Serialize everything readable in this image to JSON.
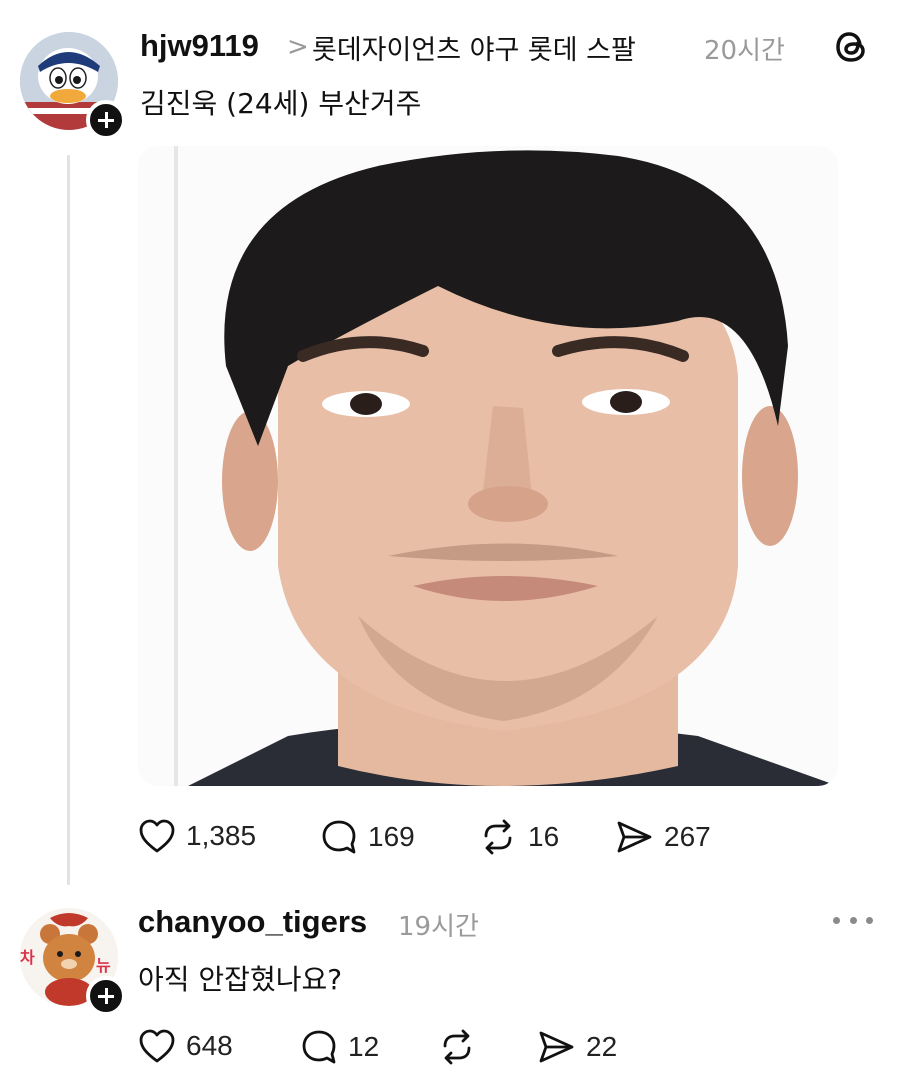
{
  "post": {
    "username": "hjw9119",
    "separator": ">",
    "community": "롯데자이언츠 야구 롯데 스팔",
    "time": "20시간",
    "text": "김진욱 (24세) 부산거주",
    "stats": {
      "likes": "1,385",
      "replies": "169",
      "reposts": "16",
      "shares": "267"
    }
  },
  "reply": {
    "username": "chanyoo_tigers",
    "time": "19시간",
    "text": "아직 안잡혔나요?",
    "avatar_text_left": "차",
    "avatar_text_right": "뉴",
    "stats": {
      "likes": "648",
      "replies": "12",
      "reposts": "",
      "shares": "22"
    }
  },
  "icons": {
    "app_logo": "threads-logo-icon",
    "like": "heart-icon",
    "reply": "comment-bubble-icon",
    "repost": "repost-icon",
    "share": "send-icon",
    "more": "more-dots-icon"
  }
}
